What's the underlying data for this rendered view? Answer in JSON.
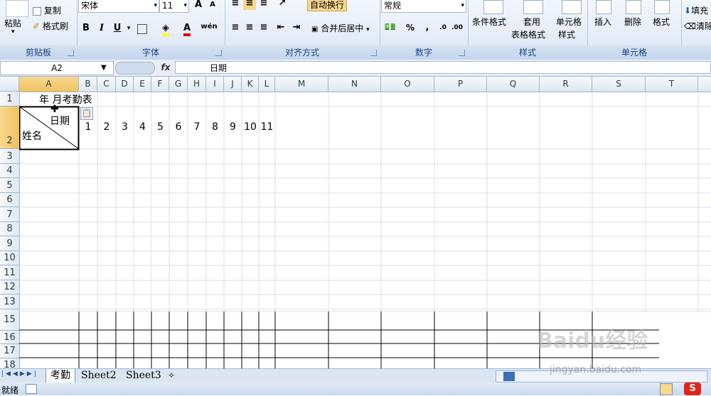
{
  "ribbon": {
    "clipboard": {
      "paste": "粘贴",
      "copy": "复制",
      "format_painter": "格式刷",
      "label": "剪贴板"
    },
    "font": {
      "name": "宋体",
      "size": "11",
      "label": "字体"
    },
    "alignment": {
      "wrap": "自动换行",
      "merge": "合并后居中",
      "label": "对齐方式"
    },
    "number": {
      "format": "常规",
      "label": "数字"
    },
    "styles": {
      "conditional": "条件格式",
      "table_1": "套用",
      "table_2": "表格格式",
      "cell_style_1": "单元格",
      "cell_style_2": "样式",
      "label": "样式"
    },
    "cells": {
      "insert": "插入",
      "delete": "删除",
      "format": "格式",
      "label": "单元格"
    },
    "editing": {
      "fill": "填充",
      "clear": "清除"
    }
  },
  "formula_bar": {
    "name_box": "A2",
    "fx": "fx",
    "content": "日期"
  },
  "columns": [
    "A",
    "B",
    "C",
    "D",
    "E",
    "F",
    "G",
    "H",
    "I",
    "J",
    "K",
    "L",
    "M",
    "N",
    "O",
    "P",
    "Q",
    "R",
    "S",
    "T"
  ],
  "rows": [
    "1",
    "2",
    "3",
    "4",
    "5",
    "6",
    "7",
    "8",
    "9",
    "10",
    "11",
    "12",
    "13",
    "15",
    "16",
    "17",
    "18"
  ],
  "cells": {
    "a1": "年     月考勤表",
    "a2_top": "日期",
    "a2_bottom": "姓名",
    "row2_numbers": [
      "1",
      "2",
      "3",
      "4",
      "5",
      "6",
      "7",
      "8",
      "9",
      "10",
      "11"
    ]
  },
  "sheets": [
    "考勤",
    "Sheet2",
    "Sheet3"
  ],
  "status": {
    "ready": "就绪"
  },
  "watermark": {
    "brand": "Baidu经验",
    "url": "jingyan.baidu.com"
  }
}
